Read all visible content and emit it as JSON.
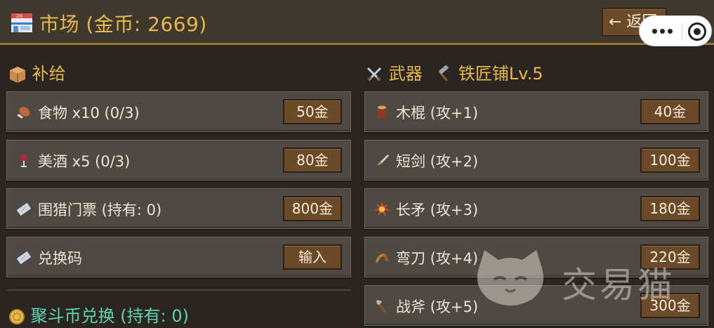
{
  "header": {
    "title": "市场 (金币: 2669)",
    "back_label": "← 返回",
    "title_icon": "convenience-store-icon"
  },
  "supplies": {
    "heading": "补给",
    "heading_icon": "package-icon",
    "items": [
      {
        "icon": "meat-icon",
        "label": "食物 x10 (0/3)",
        "price": "50金"
      },
      {
        "icon": "wine-glass-icon",
        "label": "美酒 x5 (0/3)",
        "price": "80金"
      },
      {
        "icon": "ticket-icon",
        "label": "围猎门票 (持有: 0)",
        "price": "800金"
      },
      {
        "icon": "ticket-icon",
        "label": "兑换码",
        "price": "输入"
      }
    ]
  },
  "coin_exchange": {
    "heading": "聚斗币兑换 (持有: 0)",
    "heading_icon": "coin-icon"
  },
  "weapons": {
    "heading": "武器",
    "heading_icon": "crossed-swords-icon",
    "smithy_label": "铁匠铺Lv.5",
    "smithy_icon": "hammer-icon",
    "items": [
      {
        "icon": "wood-icon",
        "label": "木棍 (攻+1)",
        "price": "40金"
      },
      {
        "icon": "dagger-icon",
        "label": "短剑 (攻+2)",
        "price": "100金"
      },
      {
        "icon": "collision-icon",
        "label": "长矛 (攻+3)",
        "price": "180金"
      },
      {
        "icon": "boomerang-icon",
        "label": "弯刀 (攻+4)",
        "price": "220金"
      },
      {
        "icon": "axe-icon",
        "label": "战斧 (攻+5)",
        "price": "300金"
      }
    ]
  },
  "watermark": {
    "text": "交易猫",
    "icon": "cat-logo-icon"
  },
  "colors": {
    "accent_gold": "#e8b94a",
    "accent_teal": "#5fd3b4",
    "button_brown": "#6b4a2a",
    "row_bg": "#4e4a43"
  }
}
